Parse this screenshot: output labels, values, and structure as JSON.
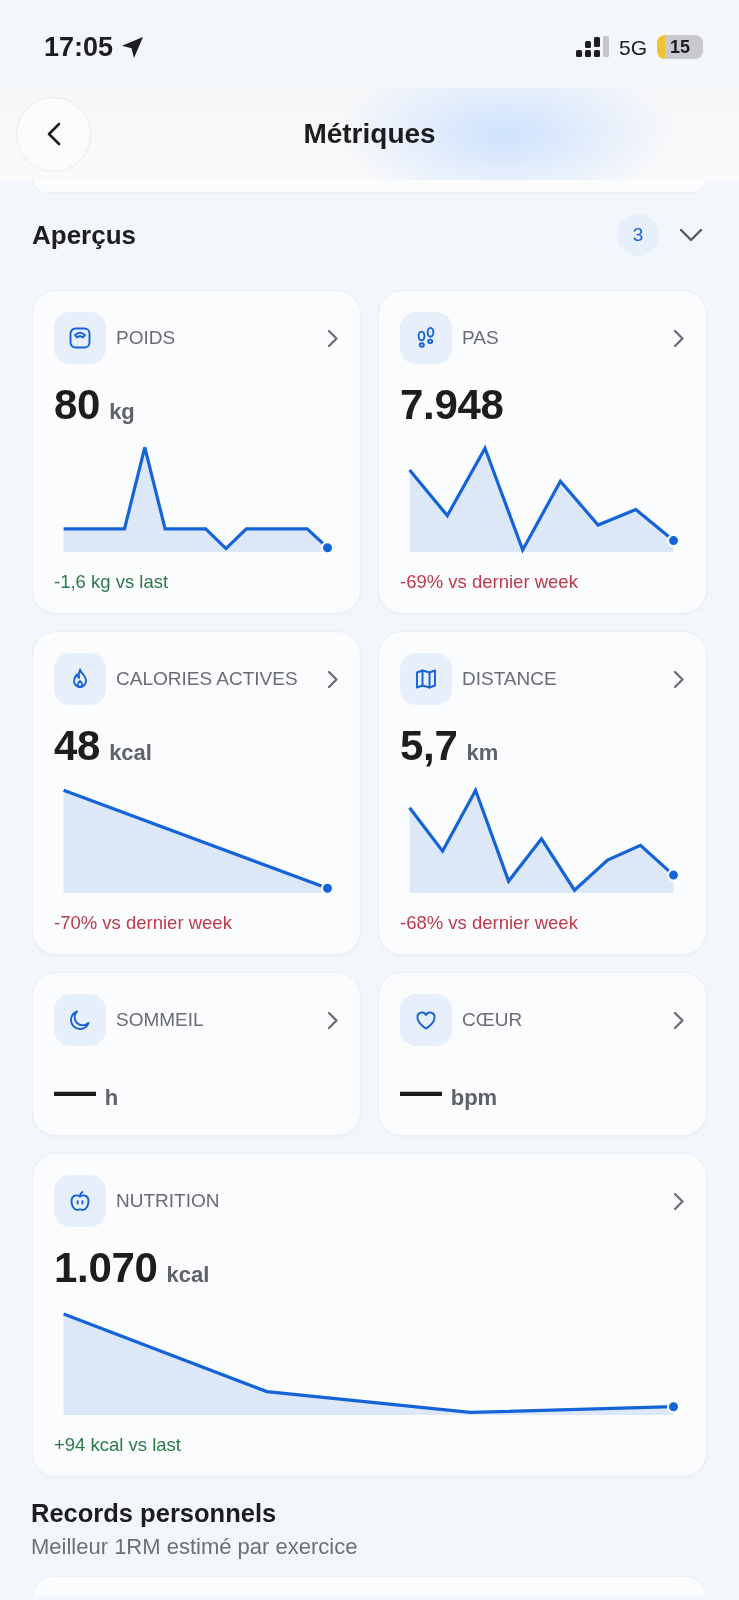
{
  "status_bar": {
    "time": "17:05",
    "network": "5G",
    "battery": "15"
  },
  "header": {
    "title": "Métriques"
  },
  "overview": {
    "title": "Aperçus",
    "count": "3",
    "cards": [
      {
        "kind": "trend",
        "label": "POIDS",
        "value": "80",
        "unit": "kg",
        "delta": "-1,6 kg vs last",
        "favorable": true
      },
      {
        "kind": "trend",
        "label": "PAS",
        "value": "7.948",
        "delta": "-69% vs dernier week",
        "favorable": false
      },
      {
        "kind": "trend",
        "label": "CALORIES ACTIVES",
        "value": "48",
        "unit": "kcal",
        "delta": "-70% vs dernier week",
        "favorable": false
      },
      {
        "kind": "trend",
        "label": "DISTANCE",
        "value": "5,7",
        "unit": "km",
        "delta": "-68% vs dernier week",
        "favorable": false
      },
      {
        "kind": "empty",
        "label": "SOMMEIL",
        "value": "—",
        "unit": "h"
      },
      {
        "kind": "empty",
        "label": "CŒUR",
        "value": "—",
        "unit": "bpm"
      },
      {
        "kind": "wide",
        "label": "NUTRITION",
        "value": "1.070",
        "unit": "kcal",
        "delta": "+94 kcal vs last",
        "favorable": true
      }
    ]
  },
  "records": {
    "title": "Records personnels",
    "subtitle": "Meilleur 1RM estimé par exercice"
  }
}
